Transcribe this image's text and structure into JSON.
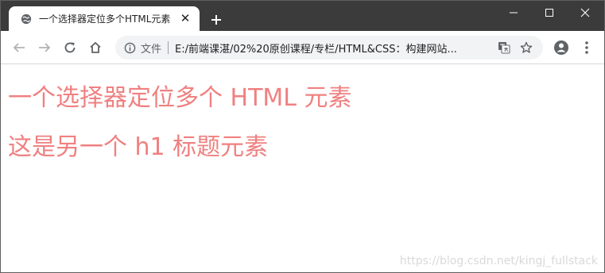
{
  "tab": {
    "title": "一个选择器定位多个HTML元素",
    "favicon": "globe-icon",
    "close_icon": "close-icon"
  },
  "window_controls": [
    "minimize-icon",
    "maximize-icon",
    "close-icon"
  ],
  "toolbar": {
    "site_label": "文件",
    "url": "E:/前端课湛/02%20原创课程/专栏/HTML&CSS：构建网站..."
  },
  "page": {
    "headings": [
      "一个选择器定位多个 HTML 元素",
      "这是另一个 h1 标题元素"
    ],
    "heading_color": "#f08080"
  },
  "watermark": "https://blog.csdn.net/kingj_fullstack"
}
